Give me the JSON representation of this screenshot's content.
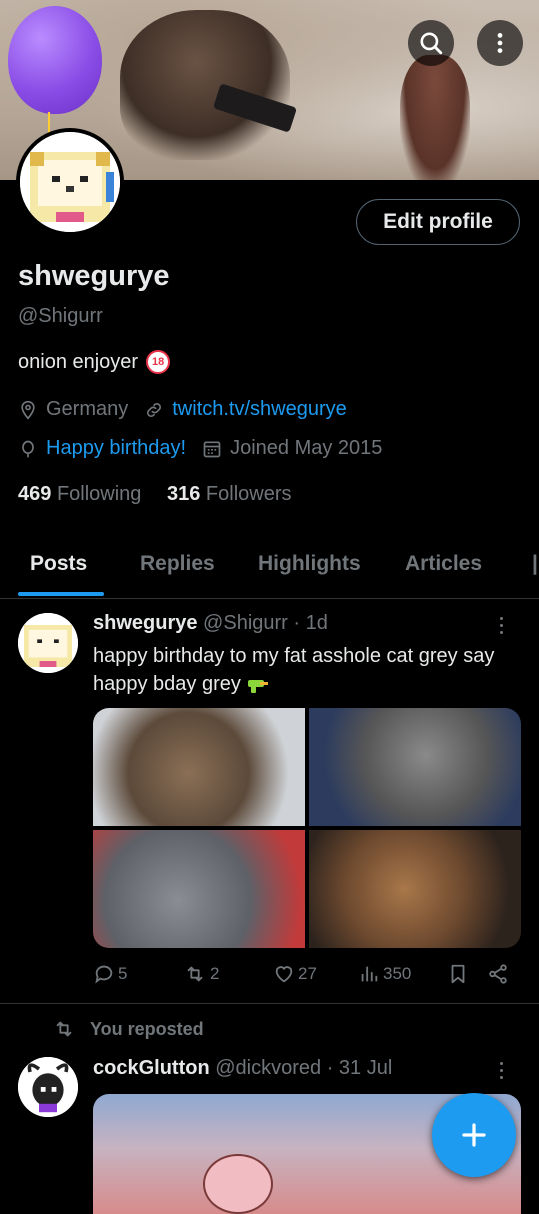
{
  "header": {
    "search_icon": "search-icon",
    "more_icon": "more-vertical-icon"
  },
  "profile": {
    "display_name": "shwegurye",
    "handle": "@Shigurr",
    "edit_label": "Edit profile",
    "bio": "onion enjoyer",
    "bio_badge": "18",
    "location": "Germany",
    "website": "twitch.tv/shwegurye",
    "birthday": "Happy birthday!",
    "joined": "Joined May 2015",
    "following_count": "469",
    "following_label": "Following",
    "followers_count": "316",
    "followers_label": "Followers"
  },
  "tabs": [
    {
      "label": "Posts"
    },
    {
      "label": "Replies"
    },
    {
      "label": "Highlights"
    },
    {
      "label": "Articles"
    }
  ],
  "post1": {
    "author": "shwegurye",
    "handle": "@Shigurr",
    "time": "· 1d",
    "text": "happy birthday to my fat asshole cat grey say happy bday grey",
    "replies": "5",
    "reposts": "2",
    "likes": "27",
    "views": "350"
  },
  "repost_label": "You reposted",
  "post2": {
    "author": "cockGlutton",
    "handle": "@dickvored",
    "time": "· 31 Jul"
  },
  "colors": {
    "accent": "#1d9bf0",
    "background": "#000000",
    "muted": "#71767b"
  }
}
